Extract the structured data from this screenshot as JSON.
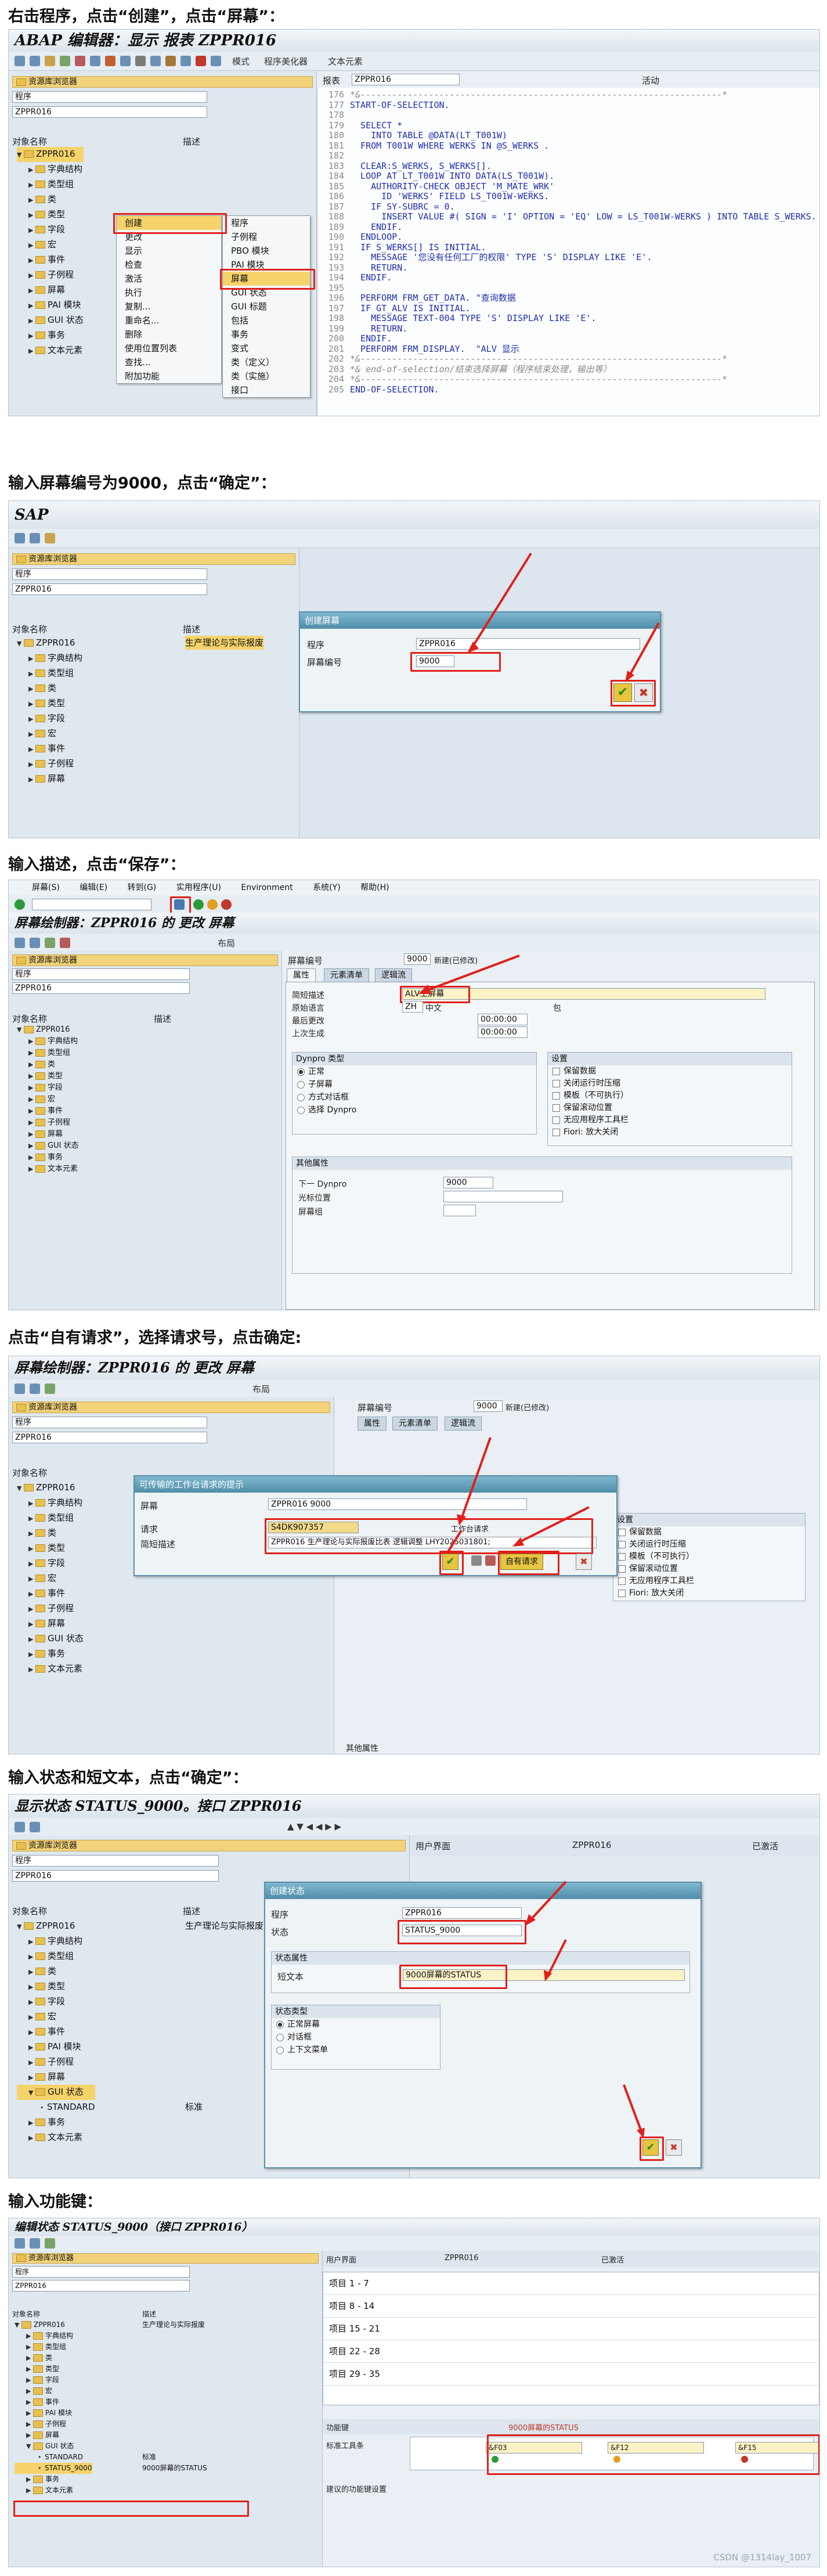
{
  "captions": {
    "step1": "右击程序，点击“创建”，点击“屏幕”：",
    "step2": "输入屏幕编号为9000，点击“确定”：",
    "step3": "输入描述，点击“保存”：",
    "step4": "点击“自有请求”，选择请求号，点击确定:",
    "step5": "输入状态和短文本，点击“确定”：",
    "step6": "输入功能键："
  },
  "s1": {
    "title": "ABAP 编辑器：显示 报表 ZPPR016",
    "toolbar_labels": [
      "模式",
      "程序美化器",
      "文本元素"
    ],
    "report_label": "报表",
    "report_value": "ZPPR016",
    "status": "活动",
    "repo_header": "资源库浏览器",
    "obj_type": "程序",
    "obj_name": "ZPPR016",
    "col_name": "对象名称",
    "col_desc": "描述",
    "tree": [
      "ZPPR016",
      "字典结构",
      "类型组",
      "类",
      "类型",
      "字段",
      "宏",
      "事件",
      "子例程",
      "屏幕",
      "PAI 模块",
      "GUI 状态",
      "事务",
      "文本元素"
    ],
    "menu1": [
      "创建",
      "更改",
      "显示",
      "检查",
      "激活",
      "执行",
      "复制...",
      "重命名...",
      "删除",
      "使用位置列表",
      "查找...",
      "附加功能"
    ],
    "menu2": [
      "程序",
      "子例程",
      "PBO 模块",
      "PAI 模块",
      "屏幕",
      "GUI 状态",
      "GUI 标题",
      "包括",
      "事务",
      "变式",
      "类（定义）",
      "类（实施）",
      "接口"
    ],
    "code": [
      {
        "ln": "176",
        "t": "*&---------------------------------------------------------------------*"
      },
      {
        "ln": "177",
        "t": "START-OF-SELECTION."
      },
      {
        "ln": "178",
        "t": ""
      },
      {
        "ln": "179",
        "t": "  SELECT *"
      },
      {
        "ln": "180",
        "t": "    INTO TABLE @DATA(LT_T001W)"
      },
      {
        "ln": "181",
        "t": "  FROM T001W WHERE WERKS IN @S_WERKS ."
      },
      {
        "ln": "182",
        "t": ""
      },
      {
        "ln": "183",
        "t": "  CLEAR:S_WERKS, S_WERKS[]."
      },
      {
        "ln": "184",
        "t": "  LOOP AT LT_T001W INTO DATA(LS_T001W)."
      },
      {
        "ln": "185",
        "t": "    AUTHORITY-CHECK OBJECT 'M_MATE_WRK'"
      },
      {
        "ln": "186",
        "t": "      ID 'WERKS' FIELD LS_T001W-WERKS."
      },
      {
        "ln": "187",
        "t": "    IF SY-SUBRC = 0."
      },
      {
        "ln": "188",
        "t": "      INSERT VALUE #( SIGN = 'I' OPTION = 'EQ' LOW = LS_T001W-WERKS ) INTO TABLE S_WERKS."
      },
      {
        "ln": "189",
        "t": "    ENDIF."
      },
      {
        "ln": "190",
        "t": "  ENDLOOP."
      },
      {
        "ln": "191",
        "t": "  IF S_WERKS[] IS INITIAL."
      },
      {
        "ln": "192",
        "t": "    MESSAGE '您没有任何工厂的权限' TYPE 'S' DISPLAY LIKE 'E'."
      },
      {
        "ln": "193",
        "t": "    RETURN."
      },
      {
        "ln": "194",
        "t": "  ENDIF."
      },
      {
        "ln": "195",
        "t": ""
      },
      {
        "ln": "196",
        "t": "  PERFORM FRM_GET_DATA. \"查询数据"
      },
      {
        "ln": "197",
        "t": "  IF GT_ALV IS INITIAL."
      },
      {
        "ln": "198",
        "t": "    MESSAGE TEXT-004 TYPE 'S' DISPLAY LIKE 'E'."
      },
      {
        "ln": "199",
        "t": "    RETURN."
      },
      {
        "ln": "200",
        "t": "  ENDIF."
      },
      {
        "ln": "201",
        "t": "  PERFORM FRM_DISPLAY.  \"ALV 显示"
      },
      {
        "ln": "202",
        "t": "*&---------------------------------------------------------------------*"
      },
      {
        "ln": "203",
        "t": "*& end-of-selection/结束选择屏幕（程序结束处理，输出等）"
      },
      {
        "ln": "204",
        "t": "*&---------------------------------------------------------------------*"
      },
      {
        "ln": "205",
        "t": "END-OF-SELECTION."
      }
    ]
  },
  "s2": {
    "title": "SAP",
    "dlg_title": "创建屏幕",
    "prog_label": "程序",
    "prog_value": "ZPPR016",
    "screen_label": "屏幕编号",
    "screen_value": "9000",
    "tree_desc": "生产理论与实际报废"
  },
  "s3": {
    "menu": [
      "屏幕(S)",
      "编辑(E)",
      "转到(G)",
      "实用程序(U)",
      "Environment",
      "系统(Y)",
      "帮助(H)"
    ],
    "title": "屏幕绘制器：ZPPR016 的 更改 屏幕",
    "layout_btn": "布局",
    "screen_no_label": "屏幕编号",
    "screen_no": "9000",
    "screen_state": "新建(已修改)",
    "tabs": [
      "属性",
      "元素清单",
      "逻辑流"
    ],
    "short_desc_label": "简短描述",
    "short_desc": "ALV主屏幕",
    "orig_lang_label": "原始语言",
    "orig_lang": "ZH",
    "orig_lang_name": "中文",
    "pkg_label": "包",
    "last_change_label": "最后更改",
    "last_gen_label": "上次生成",
    "time1": "00:00:00",
    "time2": "00:00:00",
    "dynpro_type_header": "Dynpro 类型",
    "dynpro_types": [
      "正常",
      "子屏幕",
      "方式对话框",
      "选择 Dynpro"
    ],
    "settings_header": "设置",
    "settings": [
      "保留数据",
      "关闭运行时压缩",
      "模板（不可执行）",
      "保留滚动位置",
      "无应用程序工具栏",
      "Fiori: 放大关闭"
    ],
    "other_attr_header": "其他属性",
    "next_dynpro_label": "下一 Dynpro",
    "next_dynpro": "9000",
    "cursor_pos_label": "光标位置",
    "screen_group_label": "屏幕组"
  },
  "s4": {
    "title": "屏幕绘制器：ZPPR016 的 更改 屏幕",
    "dlg_title": "可传输的工作台请求的提示",
    "object_label": "屏幕",
    "object_value": "ZPPR016 9000",
    "request_label": "请求",
    "request_value": "S4DK907357",
    "workbench_label": "工作台请求",
    "desc_label": "简短描述",
    "desc_value": "ZPPR016 生产理论与实际报废比表 逻辑调整 LHY2025031801;",
    "own_req_btn": "自有请求",
    "other_attr": "其他属性"
  },
  "s5": {
    "title": "显示状态 STATUS_9000。接口 ZPPR016",
    "ui_label": "用户界面",
    "ui_value": "ZPPR016",
    "ui_state": "已激活",
    "dlg_title": "创建状态",
    "prog_label": "程序",
    "prog_value": "ZPPR016",
    "status_label": "状态",
    "status_value": "STATUS_9000",
    "status_attr_header": "状态属性",
    "short_text_label": "短文本",
    "short_text": "9000屏幕的STATUS",
    "status_type_header": "状态类型",
    "status_types": [
      "正常屏幕",
      "对话框",
      "上下文菜单"
    ],
    "tree_extra": [
      "STANDARD",
      "标准"
    ]
  },
  "s6": {
    "title": "编辑状态 STATUS_9000（接口 ZPPR016）",
    "ui_label": "用户界面",
    "ui_value": "ZPPR016",
    "ui_state": "已激活",
    "keys": [
      "项目 1 - 7",
      "项目 8 - 14",
      "项目 15 - 21",
      "项目 22 - 28",
      "项目 29 - 35"
    ],
    "fkey_label": "功能键",
    "fkey_status": "9000屏幕的STATUS",
    "app_tb_label": "标准工具条",
    "tree_status": "STATUS_9000",
    "tree_status_desc": "9000屏幕的STATUS",
    "fkeys": [
      "&F03",
      "&F12",
      "&F15"
    ],
    "recommend": "建议的功能键设置",
    "watermark": "CSDN @1314lay_1007"
  }
}
